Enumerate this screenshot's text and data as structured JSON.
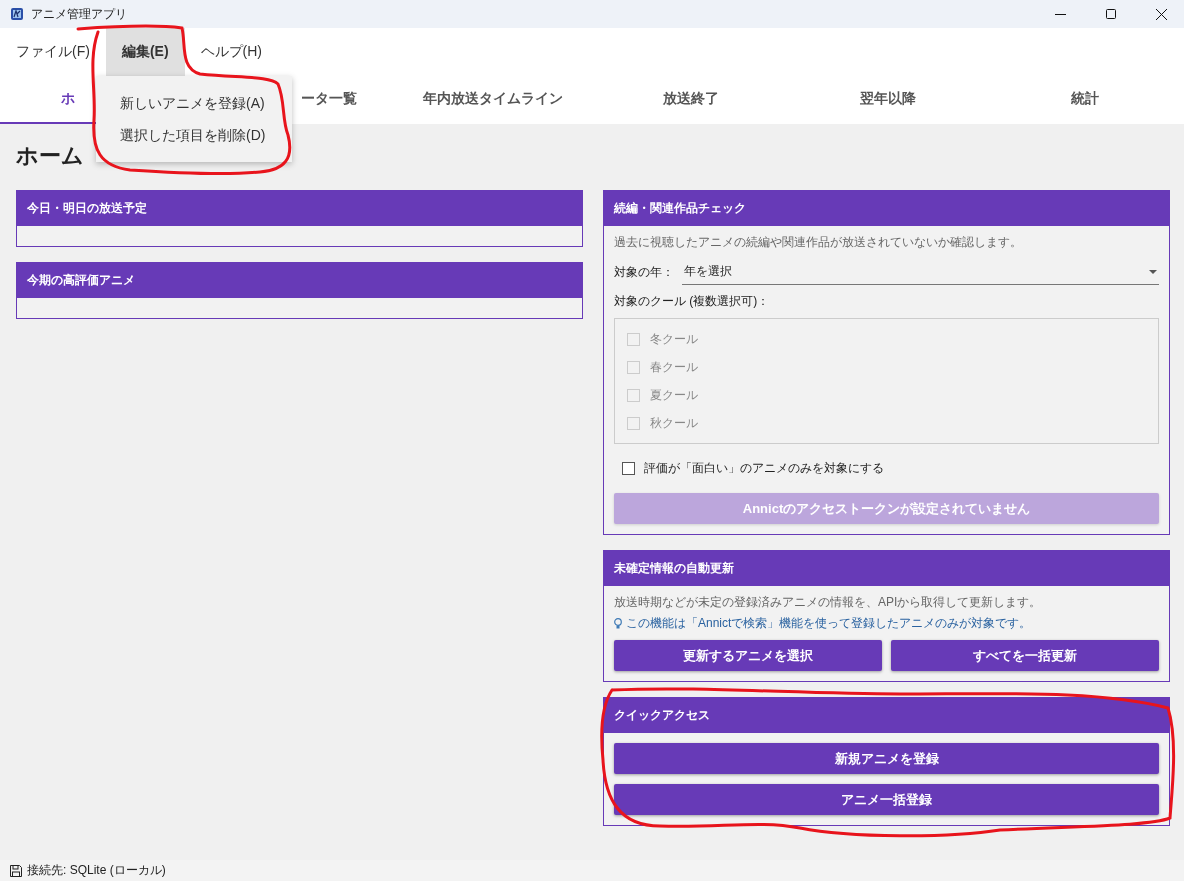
{
  "window": {
    "title": "アニメ管理アプリ"
  },
  "menu": [
    {
      "label": "ファイル(F)",
      "selected": false
    },
    {
      "label": "編集(E)",
      "selected": true
    },
    {
      "label": "ヘルプ(H)",
      "selected": false
    }
  ],
  "open_menu": {
    "items": [
      "新しいアニメを登録(A)",
      "選択した項目を削除(D)"
    ]
  },
  "tabs": [
    {
      "label": "ホ",
      "selected": true
    },
    {
      "label": "ータ一覧",
      "selected": false
    },
    {
      "label": "年内放送タイムライン",
      "selected": false
    },
    {
      "label": "放送終了",
      "selected": false
    },
    {
      "label": "翌年以降",
      "selected": false
    },
    {
      "label": "統計",
      "selected": false
    }
  ],
  "page_title": "ホーム",
  "left_panels": [
    {
      "title": "今日・明日の放送予定"
    },
    {
      "title": "今期の高評価アニメ"
    }
  ],
  "sequel_check": {
    "title": "続編・関連作品チェック",
    "description": "過去に視聴したアニメの続編や関連作品が放送されていないか確認します。",
    "year_label": "対象の年：",
    "year_value": "年を選択",
    "cour_label": "対象のクール (複数選択可)：",
    "cours": [
      {
        "label": "冬クール",
        "checked": false,
        "disabled": true
      },
      {
        "label": "春クール",
        "checked": false,
        "disabled": true
      },
      {
        "label": "夏クール",
        "checked": false,
        "disabled": true
      },
      {
        "label": "秋クール",
        "checked": false,
        "disabled": true
      }
    ],
    "filter": {
      "label": "評価が「面白い」のアニメのみを対象にする",
      "checked": false
    },
    "button": {
      "label": "Annictのアクセストークンが設定されていません",
      "disabled": true
    }
  },
  "auto_update": {
    "title": "未確定情報の自動更新",
    "description": "放送時期などが未定の登録済みアニメの情報を、APIから取得して更新します。",
    "hint": "この機能は「Annictで検索」機能を使って登録したアニメのみが対象です。",
    "buttons": [
      "更新するアニメを選択",
      "すべてを一括更新"
    ]
  },
  "quick_access": {
    "title": "クイックアクセス",
    "buttons": [
      "新規アニメを登録",
      "アニメ一括登録"
    ]
  },
  "status_bar": {
    "text": "接続先: SQLite (ローカル)"
  },
  "annotations": [
    {
      "kind": "outline"
    },
    {
      "kind": "outline"
    }
  ]
}
